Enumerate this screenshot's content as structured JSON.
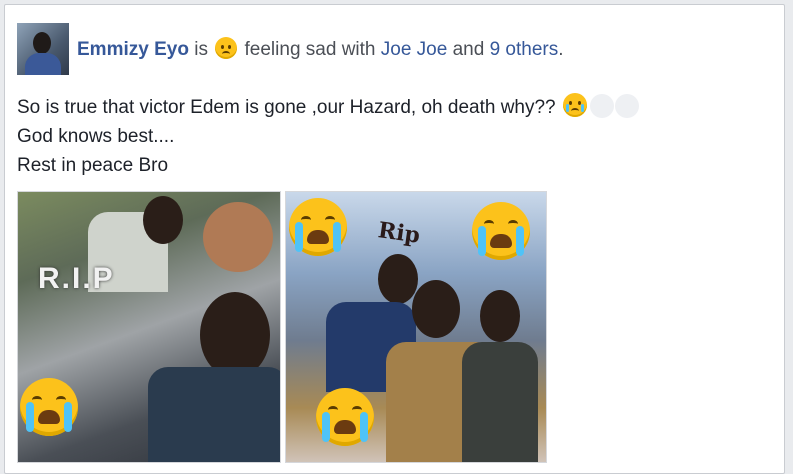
{
  "post": {
    "author": "Emmizy Eyo",
    "is_word": "is",
    "feeling_icon": "sad-face-emoji",
    "feeling_text": "feeling sad with",
    "tag_friend": "Joe Joe",
    "and_word": "and",
    "others_link": "9 others",
    "period": ".",
    "lines": [
      "So is true that victor Edem is gone ,our Hazard, oh death why??",
      "God knows best....",
      "Rest in peace Bro"
    ],
    "line1_emoji": "crying-face-emoji"
  },
  "photos": [
    {
      "overlay_text": "R.I.P",
      "emoji": "loudly-crying-face"
    },
    {
      "overlay_text": "Rip",
      "emoji": "loudly-crying-face"
    }
  ],
  "colors": {
    "link": "#365899",
    "emoji": "#fcc21b",
    "text": "#1d2129"
  }
}
